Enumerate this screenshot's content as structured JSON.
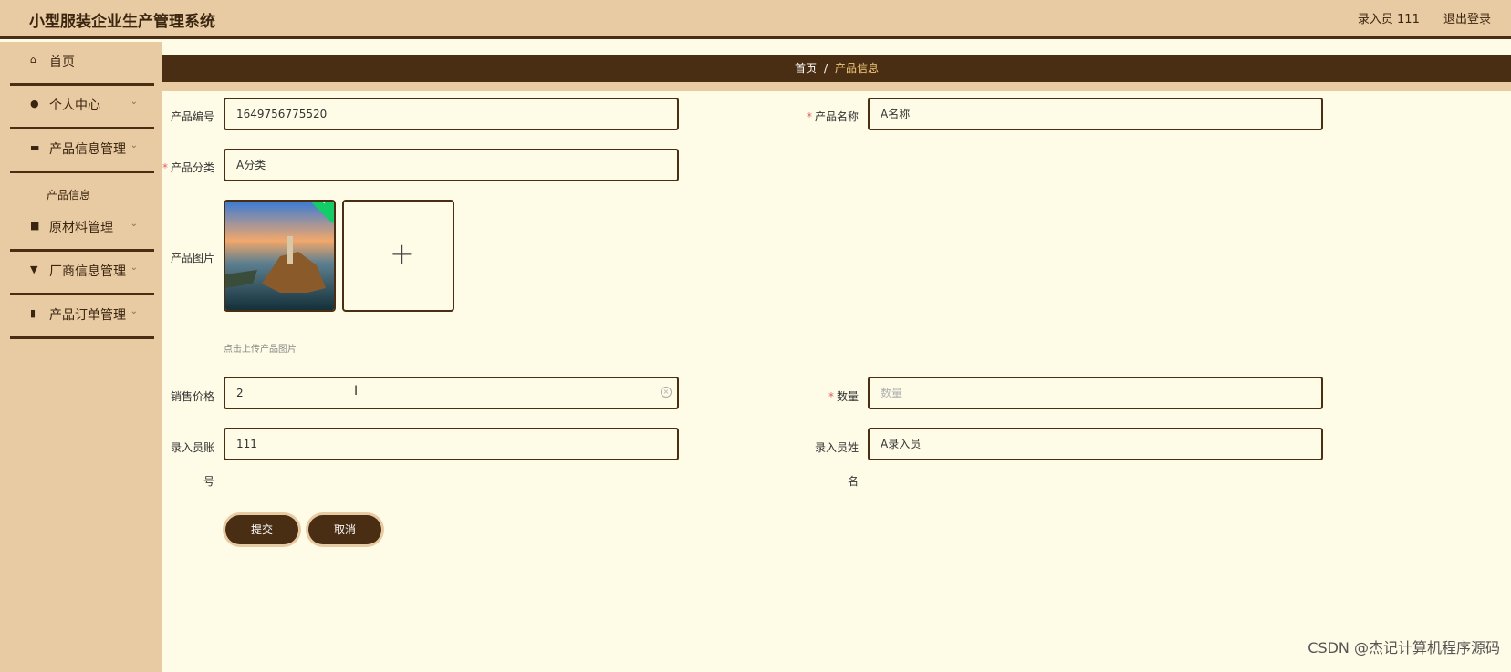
{
  "app": {
    "title": "小型服装企业生产管理系统"
  },
  "header": {
    "user": "录入员 111",
    "logout": "退出登录"
  },
  "sidebar": {
    "items": [
      {
        "label": "首页",
        "icon": "home-icon",
        "chevron": ""
      },
      {
        "label": "个人中心",
        "icon": "user-icon",
        "chevron": "⌄"
      },
      {
        "label": "产品信息管理",
        "icon": "monitor-icon",
        "chevron": "⌄"
      },
      {
        "label": "原材料管理",
        "icon": "briefcase-icon",
        "chevron": "⌄"
      },
      {
        "label": "厂商信息管理",
        "icon": "shop-icon",
        "chevron": "⌄"
      },
      {
        "label": "产品订单管理",
        "icon": "bar-chart-icon",
        "chevron": "⌄"
      }
    ],
    "submenu": "产品信息"
  },
  "breadcrumb": {
    "home": "首页",
    "sep": "/",
    "current": "产品信息"
  },
  "form": {
    "code_label": "产品编号",
    "code_value": "1649756775520",
    "name_label": "产品名称",
    "name_value": "A名称",
    "category_label": "产品分类",
    "category_value": "A分类",
    "image_label": "产品图片",
    "image_hint": "点击上传产品图片",
    "price_label": "销售价格",
    "price_value": "2",
    "qty_label": "数量",
    "qty_placeholder": "数量",
    "account_label_1": "录入员账",
    "account_label_2": "号",
    "account_value": "111",
    "clerk_name_label_1": "录入员姓",
    "clerk_name_label_2": "名",
    "clerk_name_value": "A录入员",
    "required_mark": "*",
    "submit": "提交",
    "cancel": "取消"
  },
  "watermark": "CSDN @杰记计算机程序源码"
}
